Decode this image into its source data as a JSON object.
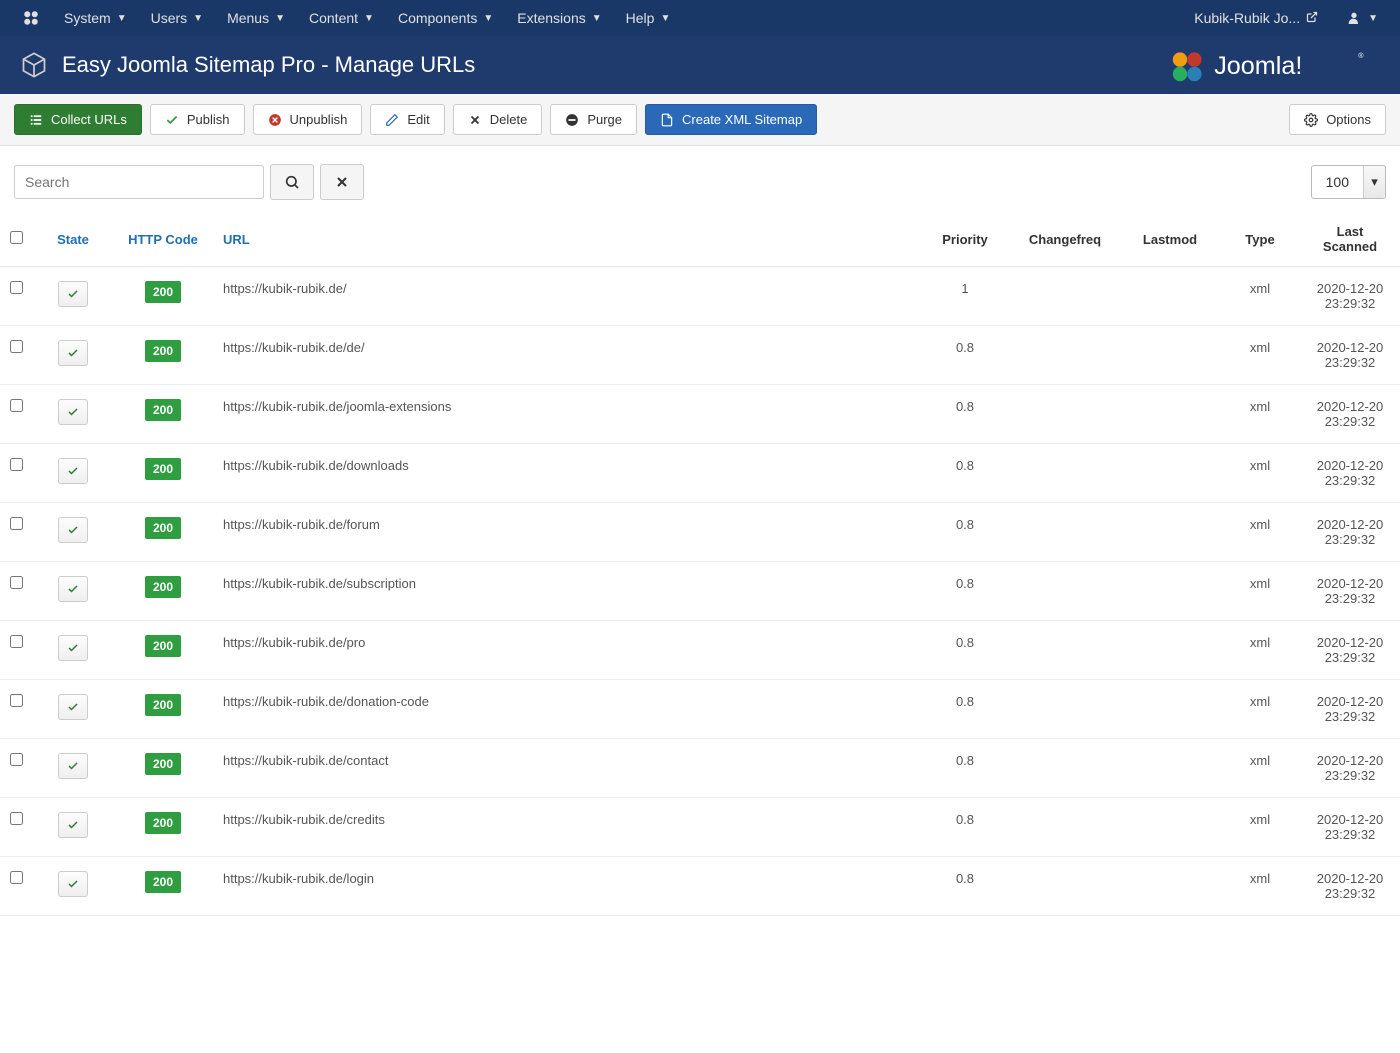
{
  "topnav": {
    "items": [
      "System",
      "Users",
      "Menus",
      "Content",
      "Components",
      "Extensions",
      "Help"
    ],
    "site_link": "Kubik-Rubik Jo..."
  },
  "titlebar": {
    "title": "Easy Joomla Sitemap Pro - Manage URLs",
    "brand": "Joomla!"
  },
  "toolbar": {
    "collect": "Collect URLs",
    "publish": "Publish",
    "unpublish": "Unpublish",
    "edit": "Edit",
    "delete": "Delete",
    "purge": "Purge",
    "create_xml": "Create XML Sitemap",
    "options": "Options"
  },
  "filter": {
    "search_placeholder": "Search",
    "limit": "100"
  },
  "table": {
    "headers": {
      "state": "State",
      "http": "HTTP Code",
      "url": "URL",
      "priority": "Priority",
      "changefreq": "Changefreq",
      "lastmod": "Lastmod",
      "type": "Type",
      "scanned": "Last Scanned"
    },
    "rows": [
      {
        "http": "200",
        "url": "https://kubik-rubik.de/",
        "priority": "1",
        "changefreq": "",
        "lastmod": "",
        "type": "xml",
        "scanned": "2020-12-20 23:29:32"
      },
      {
        "http": "200",
        "url": "https://kubik-rubik.de/de/",
        "priority": "0.8",
        "changefreq": "",
        "lastmod": "",
        "type": "xml",
        "scanned": "2020-12-20 23:29:32"
      },
      {
        "http": "200",
        "url": "https://kubik-rubik.de/joomla-extensions",
        "priority": "0.8",
        "changefreq": "",
        "lastmod": "",
        "type": "xml",
        "scanned": "2020-12-20 23:29:32"
      },
      {
        "http": "200",
        "url": "https://kubik-rubik.de/downloads",
        "priority": "0.8",
        "changefreq": "",
        "lastmod": "",
        "type": "xml",
        "scanned": "2020-12-20 23:29:32"
      },
      {
        "http": "200",
        "url": "https://kubik-rubik.de/forum",
        "priority": "0.8",
        "changefreq": "",
        "lastmod": "",
        "type": "xml",
        "scanned": "2020-12-20 23:29:32"
      },
      {
        "http": "200",
        "url": "https://kubik-rubik.de/subscription",
        "priority": "0.8",
        "changefreq": "",
        "lastmod": "",
        "type": "xml",
        "scanned": "2020-12-20 23:29:32"
      },
      {
        "http": "200",
        "url": "https://kubik-rubik.de/pro",
        "priority": "0.8",
        "changefreq": "",
        "lastmod": "",
        "type": "xml",
        "scanned": "2020-12-20 23:29:32"
      },
      {
        "http": "200",
        "url": "https://kubik-rubik.de/donation-code",
        "priority": "0.8",
        "changefreq": "",
        "lastmod": "",
        "type": "xml",
        "scanned": "2020-12-20 23:29:32"
      },
      {
        "http": "200",
        "url": "https://kubik-rubik.de/contact",
        "priority": "0.8",
        "changefreq": "",
        "lastmod": "",
        "type": "xml",
        "scanned": "2020-12-20 23:29:32"
      },
      {
        "http": "200",
        "url": "https://kubik-rubik.de/credits",
        "priority": "0.8",
        "changefreq": "",
        "lastmod": "",
        "type": "xml",
        "scanned": "2020-12-20 23:29:32"
      },
      {
        "http": "200",
        "url": "https://kubik-rubik.de/login",
        "priority": "0.8",
        "changefreq": "",
        "lastmod": "",
        "type": "xml",
        "scanned": "2020-12-20 23:29:32"
      }
    ]
  }
}
